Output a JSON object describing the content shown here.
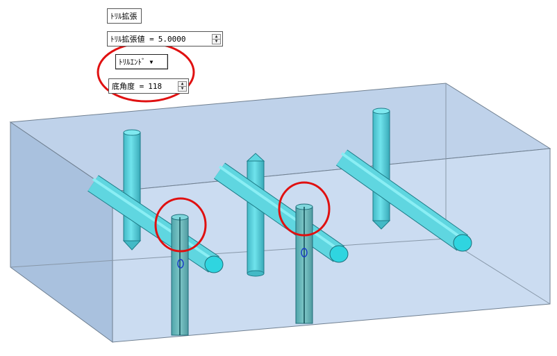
{
  "toolbar": {
    "drill_expand_label": "ﾄﾘﾙ拡張",
    "drill_expand_value_label": "ﾄﾘﾙ拡張値 =",
    "drill_expand_value": "5.0000",
    "drill_end_label": "ﾄﾘﾙｴﾝﾄﾞ",
    "bottom_angle_label": "底角度 =",
    "bottom_angle_value": "118"
  },
  "colors": {
    "box_fill": "#b9cde6",
    "box_edge": "#5f6f80",
    "cylinder_fill": "#5fd6e0",
    "cylinder_edge": "#1a6c78",
    "highlight_circle": "#e01010",
    "handle": "#1a3cc8"
  }
}
